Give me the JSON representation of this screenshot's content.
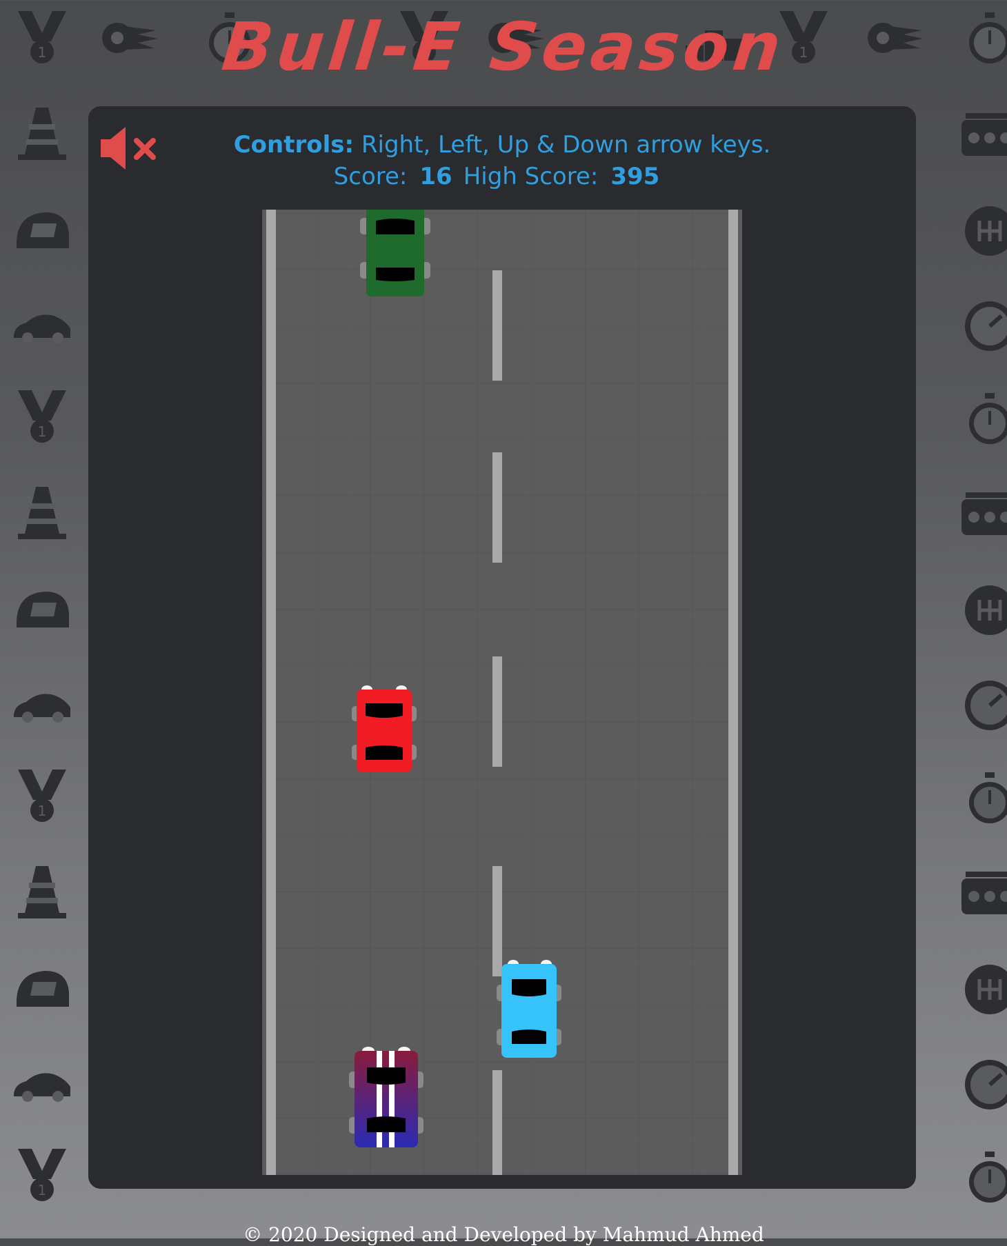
{
  "header": {
    "title": "Bull-E Season"
  },
  "controls": {
    "label": "Controls:",
    "text": "Right, Left, Up & Down arrow keys.",
    "score_label": "Score:",
    "score": "16",
    "high_score_label": "High Score:",
    "high_score": "395"
  },
  "sound": {
    "state": "muted",
    "icon": "volume-mute-icon",
    "color": "#e04b4b"
  },
  "cars": [
    {
      "name": "green-car",
      "color": "#1f6b2e"
    },
    {
      "name": "red-car",
      "color": "#f21d24"
    },
    {
      "name": "blue-car",
      "color": "#36c3fb"
    },
    {
      "name": "player-car",
      "color": "#8a1c3c"
    }
  ],
  "theme": {
    "accent": "#2f9fe0",
    "title_color": "#e04b4b",
    "panel": "#2a2b2e",
    "road": "#5c5c5d"
  },
  "footer": {
    "text": "© 2020 Designed and Developed by Mahmud Ahmed"
  }
}
